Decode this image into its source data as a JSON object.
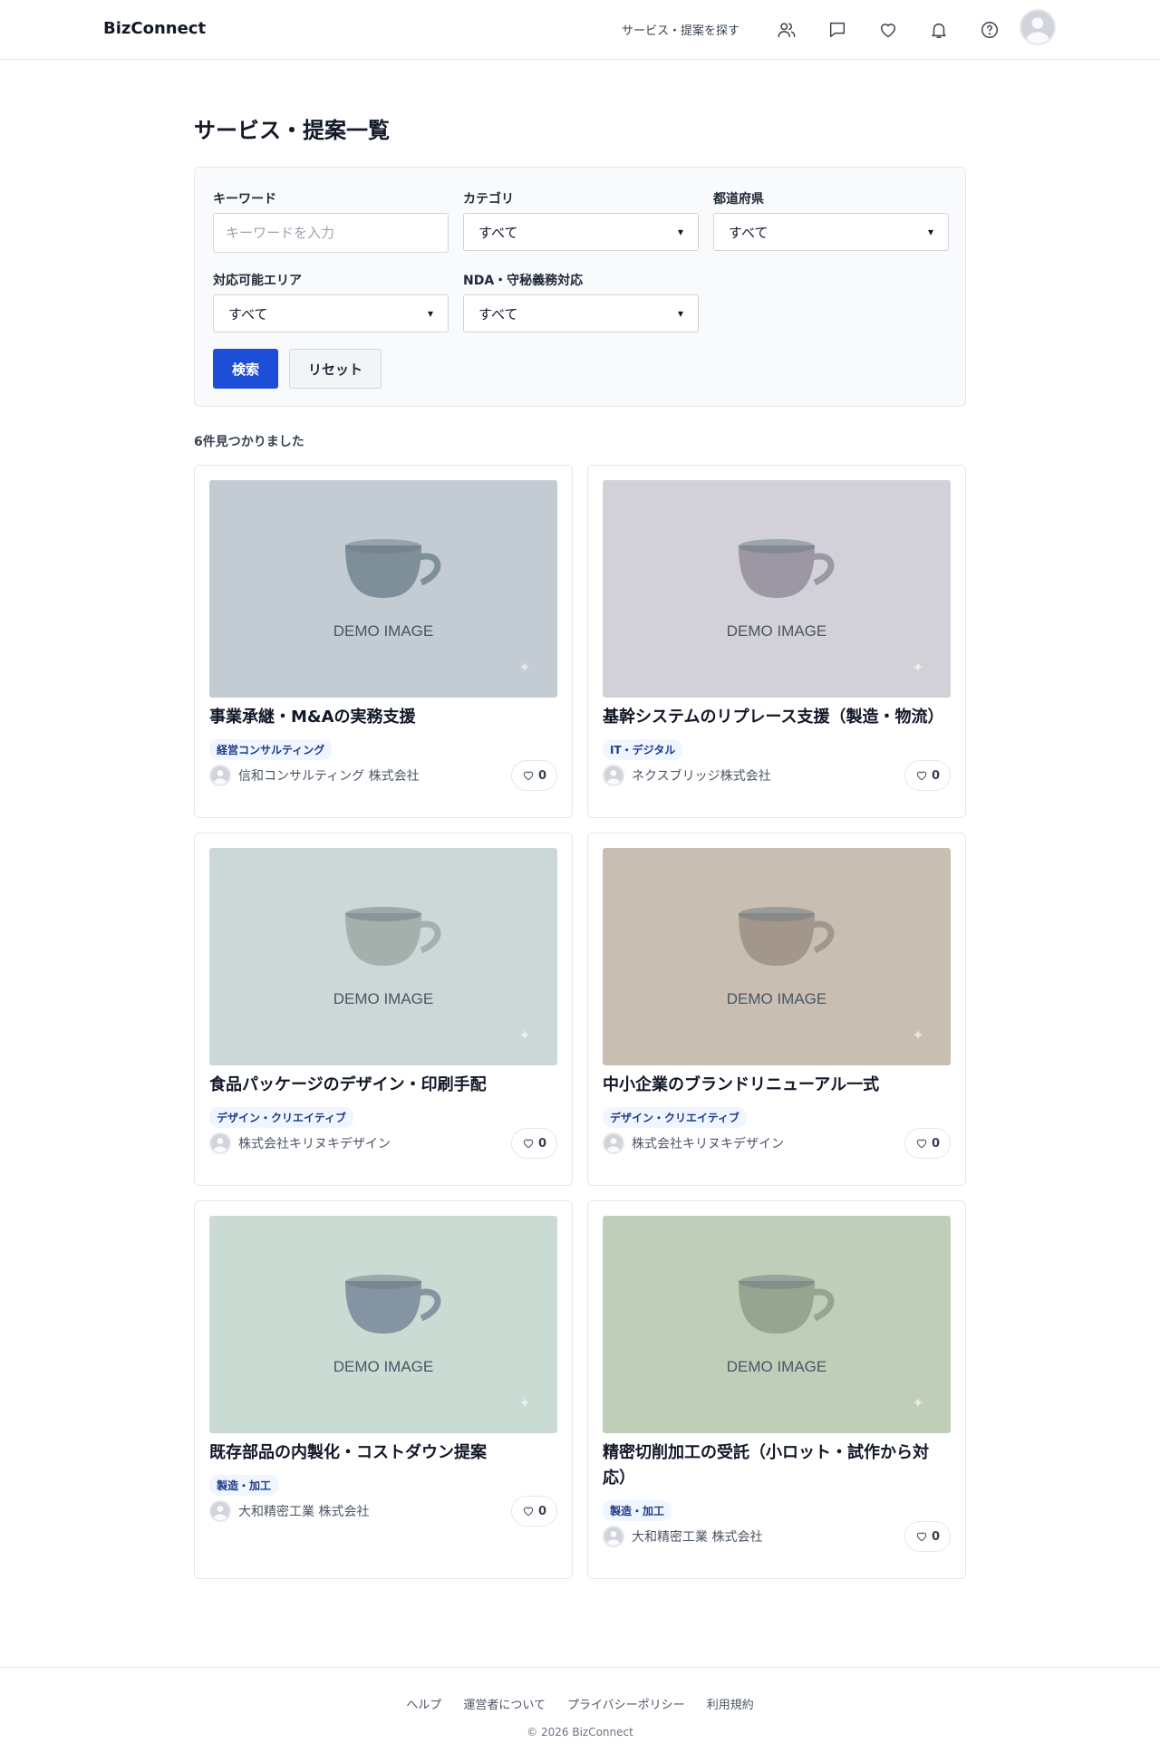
{
  "header": {
    "logo": "BizConnect",
    "nav_link": "サービス・提案を探す",
    "icons": [
      "users-icon",
      "chat-icon",
      "heart-icon",
      "bell-icon",
      "help-icon"
    ]
  },
  "page_title": "サービス・提案一覧",
  "filters": {
    "keyword_label": "キーワード",
    "keyword_placeholder": "キーワードを入力",
    "keyword_value": "",
    "category_label": "カテゴリ",
    "category_value": "すべて",
    "prefecture_label": "都道府県",
    "prefecture_value": "すべて",
    "area_label": "対応可能エリア",
    "area_value": "すべて",
    "nda_label": "NDA・守秘義務対応",
    "nda_value": "すべて",
    "search_button": "検索",
    "reset_button": "リセット"
  },
  "result_count": "6件見つかりました",
  "cards": [
    {
      "title": "事業承継・M&Aの実務支援",
      "tag": "経営コンサルティング",
      "company": "信和コンサルティング 株式会社",
      "likes": "0",
      "image_text": "DEMO IMAGE",
      "bg": "#c3cbd3",
      "cup": "#7f8f9a"
    },
    {
      "title": "基幹システムのリプレース支援（製造・物流）",
      "tag": "IT・デジタル",
      "company": "ネクスブリッジ株式会社",
      "likes": "0",
      "image_text": "DEMO IMAGE",
      "bg": "#d3d1d8",
      "cup": "#9c97a3"
    },
    {
      "title": "食品パッケージのデザイン・印刷手配",
      "tag": "デザイン・クリエイティブ",
      "company": "株式会社キリヌキデザイン",
      "likes": "0",
      "image_text": "DEMO IMAGE",
      "bg": "#ccd8d7",
      "cup": "#a3b0ab"
    },
    {
      "title": "中小企業のブランドリニューアル一式",
      "tag": "デザイン・クリエイティブ",
      "company": "株式会社キリヌキデザイン",
      "likes": "0",
      "image_text": "DEMO IMAGE",
      "bg": "#c8bfb2",
      "cup": "#a2978a"
    },
    {
      "title": "既存部品の内製化・コストダウン提案",
      "tag": "製造・加工",
      "company": "大和精密工業 株式会社",
      "likes": "0",
      "image_text": "DEMO IMAGE",
      "bg": "#c9dbd3",
      "cup": "#8495a1"
    },
    {
      "title": "精密切削加工の受託（小ロット・試作から対応）",
      "tag": "製造・加工",
      "company": "大和精密工業 株式会社",
      "likes": "0",
      "image_text": "DEMO IMAGE",
      "bg": "#c0ceb9",
      "cup": "#95a590"
    }
  ],
  "footer": {
    "links": [
      "ヘルプ",
      "運営者について",
      "プライバシーポリシー",
      "利用規約"
    ],
    "copyright": "© 2026 BizConnect"
  }
}
